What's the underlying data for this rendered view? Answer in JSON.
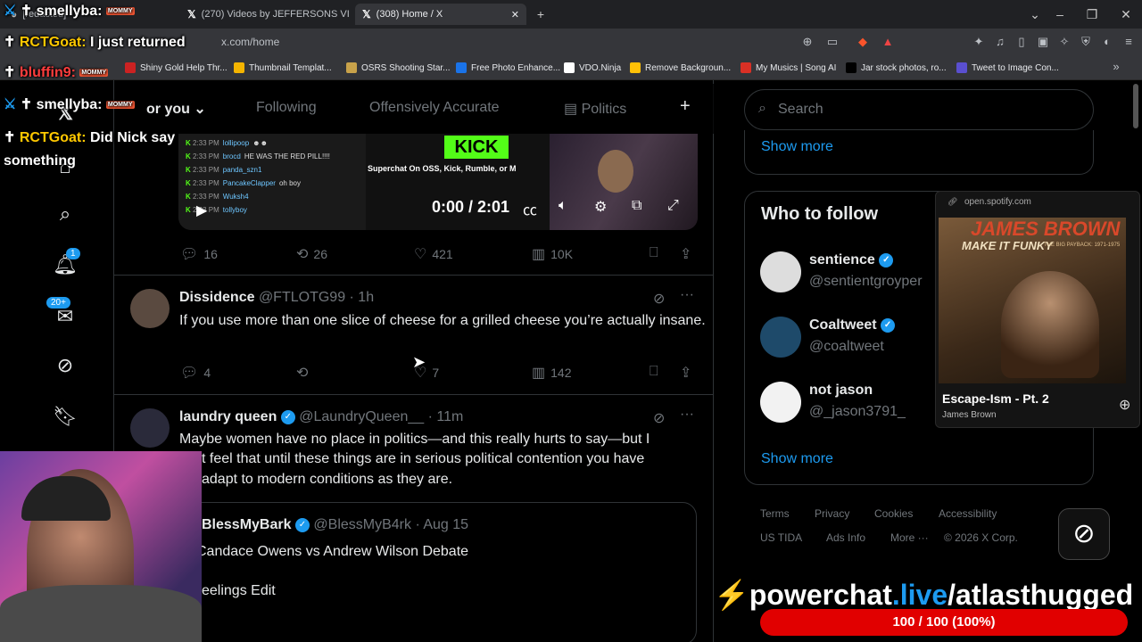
{
  "browser": {
    "tabs": [
      {
        "label": "[redacted]"
      },
      {
        "label": "(270) Videos by JEFFERSONS VIOL"
      },
      {
        "label": "(308) Home / X"
      }
    ],
    "new_tab": "+",
    "url": "x.com/home",
    "bookmarks": [
      {
        "label": "Shiny Gold Help Thr...",
        "color": "#cc2222"
      },
      {
        "label": "Thumbnail Templat...",
        "color": "#f4b400"
      },
      {
        "label": "OSRS Shooting Star...",
        "color": "#c8a24a"
      },
      {
        "label": "Free Photo Enhance...",
        "color": "#1a73e8"
      },
      {
        "label": "VDO.Ninja",
        "color": "#ffffff"
      },
      {
        "label": "Remove Backgroun...",
        "color": "#ffc107"
      },
      {
        "label": "My Musics | Song AI",
        "color": "#d93025"
      },
      {
        "label": "Jar stock photos, ro...",
        "color": "#000000"
      },
      {
        "label": "Tweet to Image Con...",
        "color": "#5a4fcf"
      }
    ]
  },
  "feed": {
    "tabs": [
      {
        "label": "or you"
      },
      {
        "label": "Following"
      },
      {
        "label": "Offensively Accurate"
      },
      {
        "label": "Politics"
      }
    ],
    "add_tab": "+",
    "video": {
      "time": "0:00 / 2:01",
      "banner": "KICK",
      "subtitle": "Superchat On OSS, Kick, Rumble, or M",
      "chat": [
        {
          "time": "2:33 PM",
          "user": "lollipoop",
          "text": "☻☻"
        },
        {
          "time": "2:33 PM",
          "user": "brocd",
          "text": "HE WAS THE RED PILL!!!!"
        },
        {
          "time": "2:33 PM",
          "user": "panda_szn1",
          "text": ""
        },
        {
          "time": "2:33 PM",
          "user": "PancakeClapper",
          "text": "oh boy"
        },
        {
          "time": "2:33 PM",
          "user": "Wuksh4",
          "text": ""
        },
        {
          "time": "2:33 PM",
          "user": "tollyboy",
          "text": ""
        }
      ]
    },
    "post1_stats": {
      "replies": "16",
      "reposts": "26",
      "likes": "421",
      "views": "10K"
    },
    "post2": {
      "name": "Dissidence",
      "handle": "@FTLOTG99 · 1h",
      "text": "If you use more than one slice of cheese for a grilled cheese you’re actually insane.",
      "replies": "4",
      "likes": "7",
      "views": "142"
    },
    "post3": {
      "name": "laundry queen",
      "handle": "@LaundryQueen__ · 11m",
      "line1": "Maybe women have no place in politics—and this really hurts to say—but I",
      "line2": "t feel that until these things are in serious political contention you have",
      "line3": "adapt to modern conditions as they are.",
      "quote": {
        "name": "BlessMyBark",
        "handle": "@BlessMyB4rk · Aug 15",
        "line1": "Candace Owens vs Andrew Wilson Debate",
        "line2": "eelings Edit"
      }
    }
  },
  "nav": {
    "notif_badge": "1",
    "msg_badge": "20+"
  },
  "sidebar": {
    "search_placeholder": "Search",
    "show_more_top": "Show more",
    "who_title": "Who to follow",
    "follows": [
      {
        "name": "sentience",
        "handle": "@sentientgroyper"
      },
      {
        "name": "Coaltweet",
        "handle": "@coaltweet"
      },
      {
        "name": "not jason",
        "handle": "@_jason3791_"
      }
    ],
    "show_more": "Show more",
    "footer": [
      "Terms",
      "Privacy",
      "Cookies",
      "Accessibility",
      "US TIDA",
      "Ads Info",
      "More ···",
      "© 2026 X Corp."
    ]
  },
  "spotify": {
    "source": "open.spotify.com",
    "cover_artist": "JAMES BROWN",
    "cover_title": "MAKE IT FUNKY",
    "cover_sub": "THE BIG PAYBACK: 1971-1975",
    "track": "Escape-Ism - Pt. 2",
    "artist": "James Brown"
  },
  "stream_chat": [
    {
      "user": "smellyba:",
      "text": "",
      "color": "#ffffff"
    },
    {
      "user": "RCTGoat:",
      "text": "I just returned",
      "color": "#ffc800"
    },
    {
      "user": "bluffin9:",
      "text": "",
      "color": "#ff3d3d"
    },
    {
      "user": "smellyba:",
      "text": "",
      "color": "#ffffff"
    },
    {
      "user": "RCTGoat:",
      "text": "Did Nick say something",
      "color": "#ffc800"
    }
  ],
  "stream_mod_badge": "MOMMY",
  "powerchat": {
    "brand_a": "powerchat",
    "brand_b": ".live",
    "brand_c": "/atlasthugged",
    "progress": "100 / 100 (100%)",
    "fraction": 1.0
  }
}
